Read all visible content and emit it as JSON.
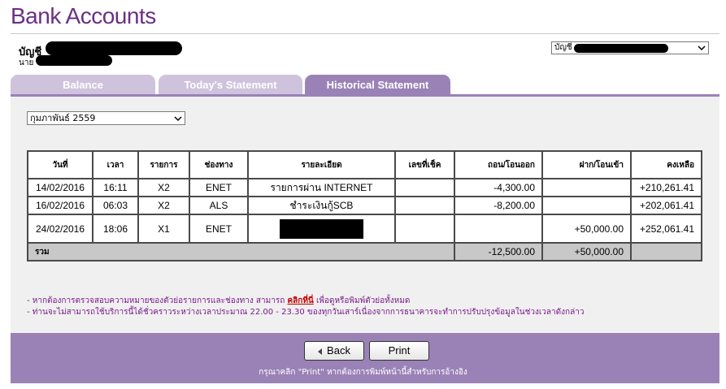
{
  "page": {
    "title": "Bank Accounts",
    "account_label": "บัญชี",
    "owner_prefix": "นาย",
    "account_select_prefix": "บัญชี"
  },
  "tabs": [
    {
      "label": "Balance",
      "active": false
    },
    {
      "label": "Today's Statement",
      "active": false
    },
    {
      "label": "Historical Statement",
      "active": true
    }
  ],
  "month_select": {
    "value": "กุมภาพันธ์ 2559"
  },
  "table": {
    "headers": [
      "วันที่",
      "เวลา",
      "รายการ",
      "ช่องทาง",
      "รายละเอียด",
      "เลขที่เช็ค",
      "ถอน/โอนออก",
      "ฝาก/โอนเข้า",
      "คงเหลือ"
    ],
    "rows": [
      {
        "date": "14/02/2016",
        "time": "16:11",
        "code": "X2",
        "channel": "ENET",
        "detail": "รายการผ่าน INTERNET",
        "cheque": "",
        "withdraw": "-4,300.00",
        "deposit": "",
        "balance": "+210,261.41"
      },
      {
        "date": "16/02/2016",
        "time": "06:03",
        "code": "X2",
        "channel": "ALS",
        "detail": "ชำระเงินกู้SCB",
        "cheque": "",
        "withdraw": "-8,200.00",
        "deposit": "",
        "balance": "+202,061.41"
      },
      {
        "date": "24/02/2016",
        "time": "18:06",
        "code": "X1",
        "channel": "ENET",
        "detail": "",
        "cheque": "",
        "withdraw": "",
        "deposit": "+50,000.00",
        "balance": "+252,061.41"
      }
    ],
    "total": {
      "label": "รวม",
      "withdraw": "-12,500.00",
      "deposit": "+50,000.00"
    }
  },
  "notes": {
    "line1_pre": "- หากต้องการตรวจสอบความหมายของตัวย่อรายการและช่องทาง สามารถ ",
    "line1_link": "คลิกที่นี่",
    "line1_post": " เพื่อดูหรือพิมพ์ตัวย่อทั้งหมด",
    "line2": "- ท่านจะไม่สามารถใช้บริการนี้ได้ชั่วคราวระหว่างเวลาประมาณ 22.00 - 23.30 ของทุกวันเสาร์เนื่องจากการธนาคารจะทำการปรับปรุงข้อมูลในช่วงเวลาดังกล่าว"
  },
  "buttons": {
    "back": "Back",
    "print": "Print"
  },
  "footer_note": "กรุณาคลิก \"Print\" หากต้องการพิมพ์หน้านี้สำหรับการอ้างอิง",
  "colors": {
    "brand": "#6b2f86",
    "tab_active": "#9a82b7",
    "tab_inactive": "#cfc2dc",
    "note_text": "#7a1a8a",
    "link": "#c00000"
  }
}
